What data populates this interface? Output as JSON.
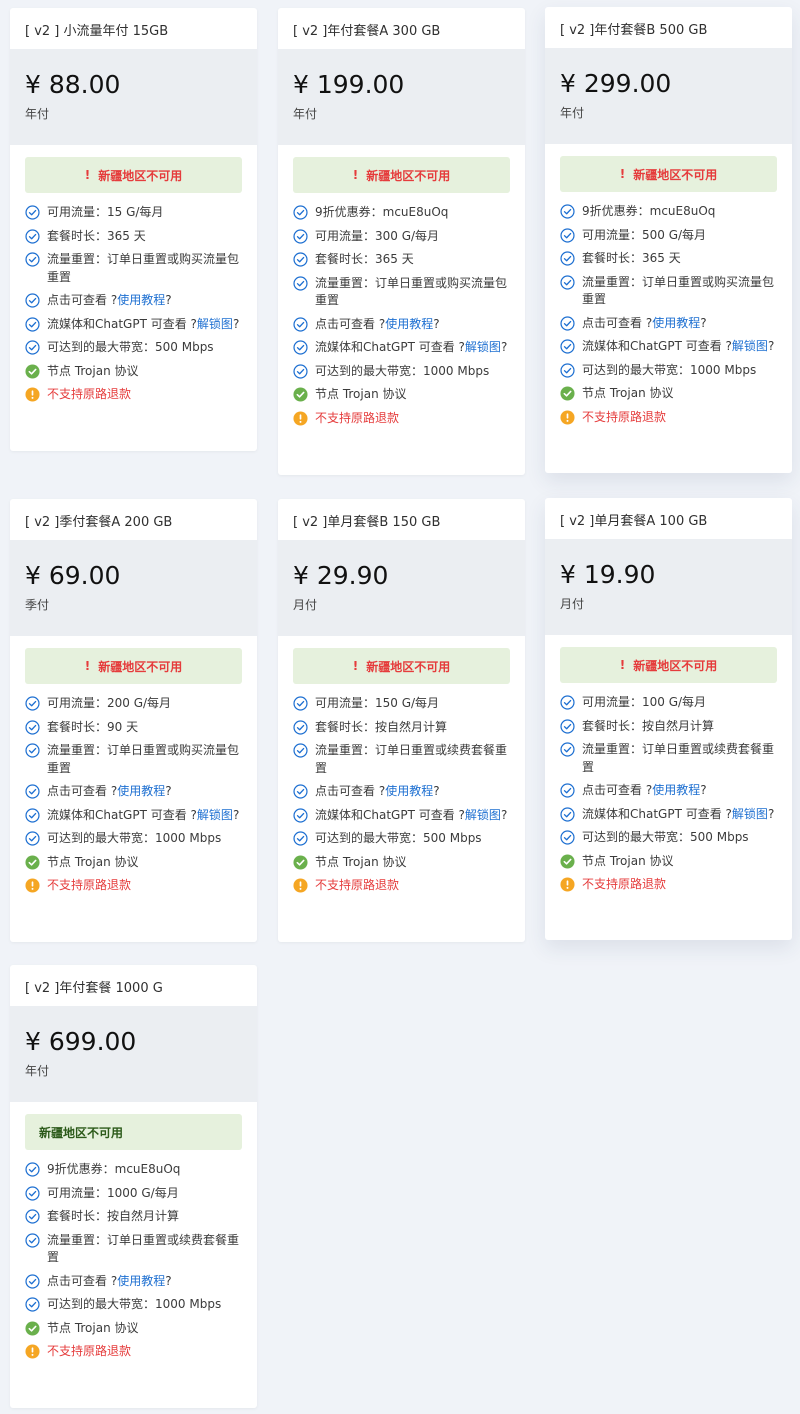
{
  "colors": {
    "background": "#f0f3f8",
    "price_block": "#ebeef2",
    "alert_bg": "#e6f1dd",
    "alert_text": "#e53c3c",
    "check_blue": "#1d6fd1",
    "check_green": "#6ab04c",
    "warn_orange": "#f5a623",
    "link": "#1d6fd1"
  },
  "plans": [
    {
      "title": "[ v2 ] 小流量年付 15GB",
      "price": "¥ 88.00",
      "period": "年付",
      "alert": "新疆地区不可用",
      "features": [
        {
          "icon": "check-circle-icon",
          "text": "可用流量：15 G/每月"
        },
        {
          "icon": "check-circle-icon",
          "text": "套餐时长：365 天"
        },
        {
          "icon": "check-circle-icon",
          "text": "流量重置：订单日重置或购买流量包重置"
        },
        {
          "icon": "check-circle-icon",
          "text": "点击可查看 ?",
          "link": "使用教程",
          "suffix": "?"
        },
        {
          "icon": "check-circle-icon",
          "text": "流媒体和ChatGPT 可查看 ?",
          "link": "解锁图",
          "suffix": "?"
        },
        {
          "icon": "check-circle-icon",
          "text": "可达到的最大带宽：500 Mbps"
        },
        {
          "icon": "check-filled-icon",
          "text": "节点 Trojan 协议"
        },
        {
          "icon": "warning-icon",
          "text": "不支持原路退款"
        }
      ]
    },
    {
      "title": "[ v2 ]年付套餐A 300 GB",
      "price": "¥ 199.00",
      "period": "年付",
      "alert": "新疆地区不可用",
      "features": [
        {
          "icon": "check-circle-icon",
          "text": "9折优惠券：mcuE8uOq"
        },
        {
          "icon": "check-circle-icon",
          "text": "可用流量：300 G/每月"
        },
        {
          "icon": "check-circle-icon",
          "text": "套餐时长：365 天"
        },
        {
          "icon": "check-circle-icon",
          "text": "流量重置：订单日重置或购买流量包重置"
        },
        {
          "icon": "check-circle-icon",
          "text": "点击可查看 ?",
          "link": "使用教程",
          "suffix": "?"
        },
        {
          "icon": "check-circle-icon",
          "text": "流媒体和ChatGPT 可查看 ?",
          "link": "解锁图",
          "suffix": "?"
        },
        {
          "icon": "check-circle-icon",
          "text": "可达到的最大带宽：1000 Mbps"
        },
        {
          "icon": "check-filled-icon",
          "text": "节点 Trojan 协议"
        },
        {
          "icon": "warning-icon",
          "text": "不支持原路退款"
        }
      ]
    },
    {
      "title": "[ v2 ]年付套餐B 500 GB",
      "price": "¥ 299.00",
      "period": "年付",
      "alert": "新疆地区不可用",
      "features": [
        {
          "icon": "check-circle-icon",
          "text": "9折优惠券：mcuE8uOq"
        },
        {
          "icon": "check-circle-icon",
          "text": "可用流量：500 G/每月"
        },
        {
          "icon": "check-circle-icon",
          "text": "套餐时长：365 天"
        },
        {
          "icon": "check-circle-icon",
          "text": "流量重置：订单日重置或购买流量包重置"
        },
        {
          "icon": "check-circle-icon",
          "text": "点击可查看 ?",
          "link": "使用教程",
          "suffix": "?"
        },
        {
          "icon": "check-circle-icon",
          "text": "流媒体和ChatGPT 可查看 ?",
          "link": "解锁图",
          "suffix": "?"
        },
        {
          "icon": "check-circle-icon",
          "text": "可达到的最大带宽：1000 Mbps"
        },
        {
          "icon": "check-filled-icon",
          "text": "节点 Trojan 协议"
        },
        {
          "icon": "warning-icon",
          "text": "不支持原路退款"
        }
      ]
    },
    {
      "title": "[ v2 ]季付套餐A 200 GB",
      "price": "¥ 69.00",
      "period": "季付",
      "alert": "新疆地区不可用",
      "features": [
        {
          "icon": "check-circle-icon",
          "text": "可用流量：200 G/每月"
        },
        {
          "icon": "check-circle-icon",
          "text": "套餐时长：90 天"
        },
        {
          "icon": "check-circle-icon",
          "text": "流量重置：订单日重置或购买流量包重置"
        },
        {
          "icon": "check-circle-icon",
          "text": "点击可查看 ?",
          "link": "使用教程",
          "suffix": "?"
        },
        {
          "icon": "check-circle-icon",
          "text": "流媒体和ChatGPT 可查看 ?",
          "link": "解锁图",
          "suffix": "?"
        },
        {
          "icon": "check-circle-icon",
          "text": "可达到的最大带宽：1000 Mbps"
        },
        {
          "icon": "check-filled-icon",
          "text": "节点 Trojan 协议"
        },
        {
          "icon": "warning-icon",
          "text": "不支持原路退款"
        }
      ]
    },
    {
      "title": "[ v2 ]单月套餐B 150 GB",
      "price": "¥ 29.90",
      "period": "月付",
      "alert": "新疆地区不可用",
      "features": [
        {
          "icon": "check-circle-icon",
          "text": "可用流量：150 G/每月"
        },
        {
          "icon": "check-circle-icon",
          "text": "套餐时长：按自然月计算"
        },
        {
          "icon": "check-circle-icon",
          "text": "流量重置：订单日重置或续费套餐重置"
        },
        {
          "icon": "check-circle-icon",
          "text": "点击可查看 ?",
          "link": "使用教程",
          "suffix": "?"
        },
        {
          "icon": "check-circle-icon",
          "text": "流媒体和ChatGPT 可查看 ?",
          "link": "解锁图",
          "suffix": "?"
        },
        {
          "icon": "check-circle-icon",
          "text": "可达到的最大带宽：500 Mbps"
        },
        {
          "icon": "check-filled-icon",
          "text": "节点 Trojan 协议"
        },
        {
          "icon": "warning-icon",
          "text": "不支持原路退款"
        }
      ]
    },
    {
      "title": "[ v2 ]单月套餐A 100 GB",
      "price": "¥ 19.90",
      "period": "月付",
      "alert": "新疆地区不可用",
      "features": [
        {
          "icon": "check-circle-icon",
          "text": "可用流量：100 G/每月"
        },
        {
          "icon": "check-circle-icon",
          "text": "套餐时长：按自然月计算"
        },
        {
          "icon": "check-circle-icon",
          "text": "流量重置：订单日重置或续费套餐重置"
        },
        {
          "icon": "check-circle-icon",
          "text": "点击可查看 ?",
          "link": "使用教程",
          "suffix": "?"
        },
        {
          "icon": "check-circle-icon",
          "text": "流媒体和ChatGPT 可查看 ?",
          "link": "解锁图",
          "suffix": "?"
        },
        {
          "icon": "check-circle-icon",
          "text": "可达到的最大带宽：500 Mbps"
        },
        {
          "icon": "check-filled-icon",
          "text": "节点 Trojan 协议"
        },
        {
          "icon": "warning-icon",
          "text": "不支持原路退款"
        }
      ]
    },
    {
      "title": "[ v2 ]年付套餐 1000 G",
      "price": "¥ 699.00",
      "period": "年付",
      "alert": "新疆地区不可用",
      "features": [
        {
          "icon": "check-circle-icon",
          "text": "9折优惠券：mcuE8uOq"
        },
        {
          "icon": "check-circle-icon",
          "text": "可用流量：1000 G/每月"
        },
        {
          "icon": "check-circle-icon",
          "text": "套餐时长：按自然月计算"
        },
        {
          "icon": "check-circle-icon",
          "text": "流量重置：订单日重置或续费套餐重置"
        },
        {
          "icon": "check-circle-icon",
          "text": "点击可查看 ?",
          "link": "使用教程",
          "suffix": "?"
        },
        {
          "icon": "check-circle-icon",
          "text": "可达到的最大带宽：1000 Mbps"
        },
        {
          "icon": "check-filled-icon",
          "text": "节点 Trojan 协议"
        },
        {
          "icon": "warning-icon",
          "text": "不支持原路退款"
        }
      ]
    }
  ]
}
